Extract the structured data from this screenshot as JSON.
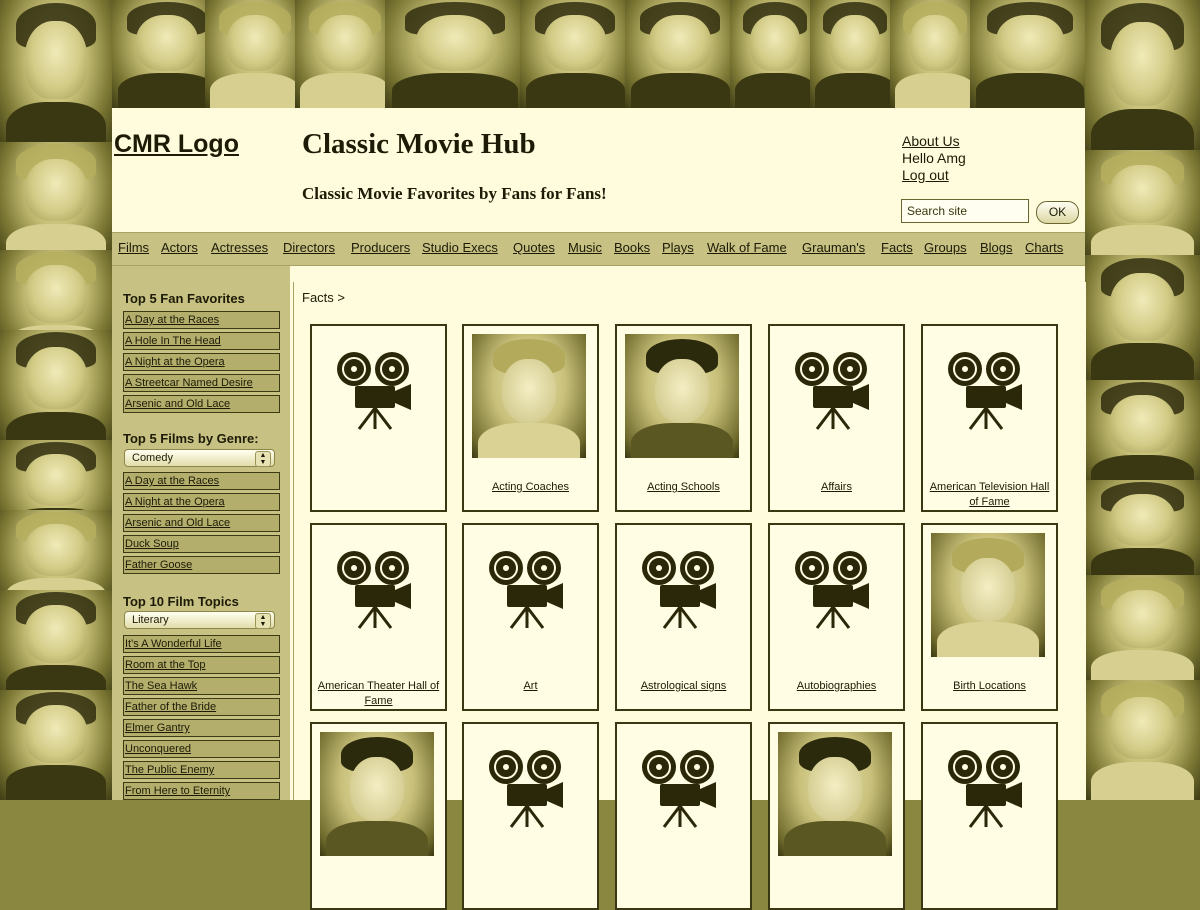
{
  "header": {
    "logo": "CMR Logo",
    "title": "Classic Movie Hub",
    "tagline": "Classic Movie Favorites by Fans for Fans!",
    "about_link": "About Us",
    "greeting": "Hello Amg",
    "logout_link": "Log out",
    "search_placeholder": "Search site",
    "ok_label": "OK"
  },
  "nav": {
    "items": [
      "Films",
      "Actors",
      "Actresses",
      "Directors",
      "Producers",
      "Studio Execs",
      "Quotes",
      "Music",
      "Books",
      "Plays",
      "Walk of Fame",
      "Grauman's",
      "Facts",
      "Groups",
      "Blogs",
      "Charts"
    ]
  },
  "sidebar": {
    "fan_favorites_title": "Top 5 Fan Favorites",
    "fan_favorites": [
      "A Day at the Races",
      "A Hole In The Head",
      "A Night at the Opera",
      "A Streetcar Named Desire",
      "Arsenic and Old Lace"
    ],
    "genre_title": "Top 5 Films by Genre:",
    "genre_selected": "Comedy",
    "genre_films": [
      "A Day at the Races",
      "A Night at the Opera",
      "Arsenic and Old Lace",
      "Duck Soup",
      "Father Goose"
    ],
    "topics_title": "Top 10 Film Topics",
    "topic_selected": "Literary",
    "topic_films": [
      "It's A Wonderful Life",
      "Room at the Top",
      "The Sea Hawk",
      "Father of the Bride",
      "Elmer Gantry",
      "Unconquered",
      "The Public Enemy",
      "From Here to Eternity"
    ]
  },
  "content": {
    "breadcrumb": "Facts >",
    "cards": [
      {
        "caption": "",
        "image": "camera-icon"
      },
      {
        "caption": "Acting Coaches",
        "image": "photo"
      },
      {
        "caption": "Acting Schools",
        "image": "photo"
      },
      {
        "caption": "Affairs",
        "image": "camera-icon"
      },
      {
        "caption": "American Television Hall of Fame",
        "image": "camera-icon"
      },
      {
        "caption": "American Theater Hall of Fame",
        "image": "camera-icon"
      },
      {
        "caption": "Art",
        "image": "camera-icon"
      },
      {
        "caption": "Astrological signs",
        "image": "camera-icon"
      },
      {
        "caption": "Autobiographies",
        "image": "camera-icon"
      },
      {
        "caption": "Birth Locations",
        "image": "photo"
      }
    ]
  },
  "colors": {
    "sepia_dark": "#1d1b06",
    "panel_bg": "#fefcdc",
    "nav_bg": "#c7c184",
    "item_bg": "#b4ae6c"
  }
}
